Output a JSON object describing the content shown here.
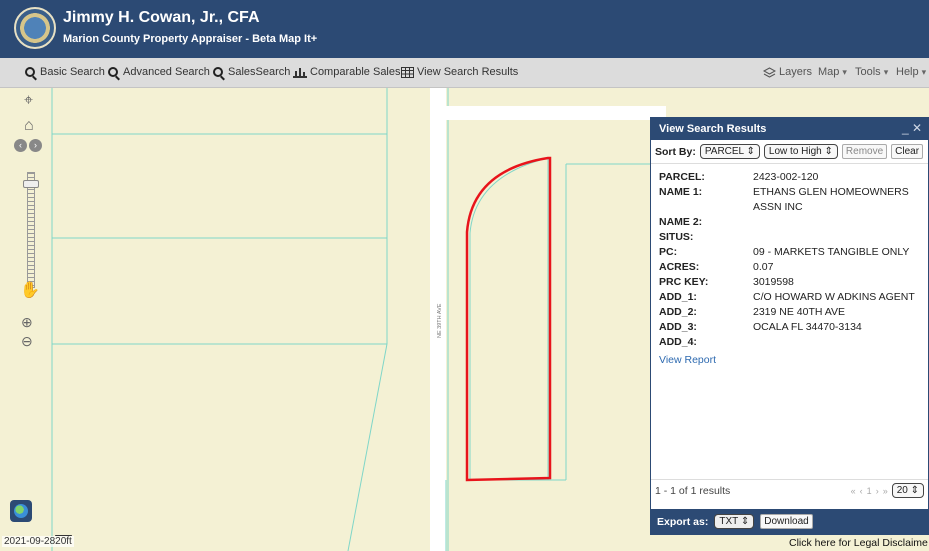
{
  "header": {
    "title": "Jimmy H. Cowan, Jr., CFA",
    "subtitle": "Marion County Property Appraiser - Beta Map It+"
  },
  "toolbar": {
    "left": [
      {
        "label": "Basic Search",
        "icon": "search-icon"
      },
      {
        "label": "Advanced Search",
        "icon": "search-icon"
      },
      {
        "label": "SalesSearch",
        "icon": "search-icon"
      },
      {
        "label": "Comparable Sales",
        "icon": "chart-icon"
      },
      {
        "label": "View Search Results",
        "icon": "table-icon"
      }
    ],
    "right": [
      {
        "label": "Layers",
        "icon": "layers-icon"
      },
      {
        "label": "Map",
        "icon": "chevron-down-icon"
      },
      {
        "label": "Tools",
        "icon": "chevron-down-icon"
      },
      {
        "label": "Help",
        "icon": "chevron-down-icon"
      }
    ]
  },
  "map": {
    "street_label": "NE 39TH AVE",
    "date": "2021-09-28",
    "scale": "20ft",
    "colors": {
      "background": "#f4f1d4",
      "parcel_line": "#7fd6c8",
      "selected_parcel": "#e8141b"
    }
  },
  "panel": {
    "title": "View Search Results",
    "sort_label": "Sort By:",
    "sort_field": "PARCEL",
    "sort_order": "Low to High",
    "remove_label": "Remove",
    "clear_label": "Clear",
    "fields": [
      {
        "label": "PARCEL:",
        "value": "2423-002-120"
      },
      {
        "label": "NAME 1:",
        "value": "ETHANS GLEN HOMEOWNERS ASSN INC"
      },
      {
        "label": "NAME 2:",
        "value": ""
      },
      {
        "label": "SITUS:",
        "value": ""
      },
      {
        "label": "PC:",
        "value": "09 - MARKETS TANGIBLE ONLY"
      },
      {
        "label": "ACRES:",
        "value": "0.07"
      },
      {
        "label": "PRC KEY:",
        "value": "3019598"
      },
      {
        "label": "ADD_1:",
        "value": "C/O HOWARD W ADKINS AGENT"
      },
      {
        "label": "ADD_2:",
        "value": "2319 NE 40TH AVE"
      },
      {
        "label": "ADD_3:",
        "value": "OCALA FL 34470-3134"
      },
      {
        "label": "ADD_4:",
        "value": ""
      }
    ],
    "view_report": "View Report",
    "results_count": "1 - 1 of 1 results",
    "page": "1",
    "page_size": "20",
    "export_label": "Export as:",
    "export_format": "TXT",
    "download_label": "Download"
  },
  "disclaimer": "Click here for Legal Disclaime",
  "colors": {
    "header_bg": "#2c4a74",
    "toolbar_bg": "#dcdcdc",
    "link": "#2e6ab0"
  }
}
